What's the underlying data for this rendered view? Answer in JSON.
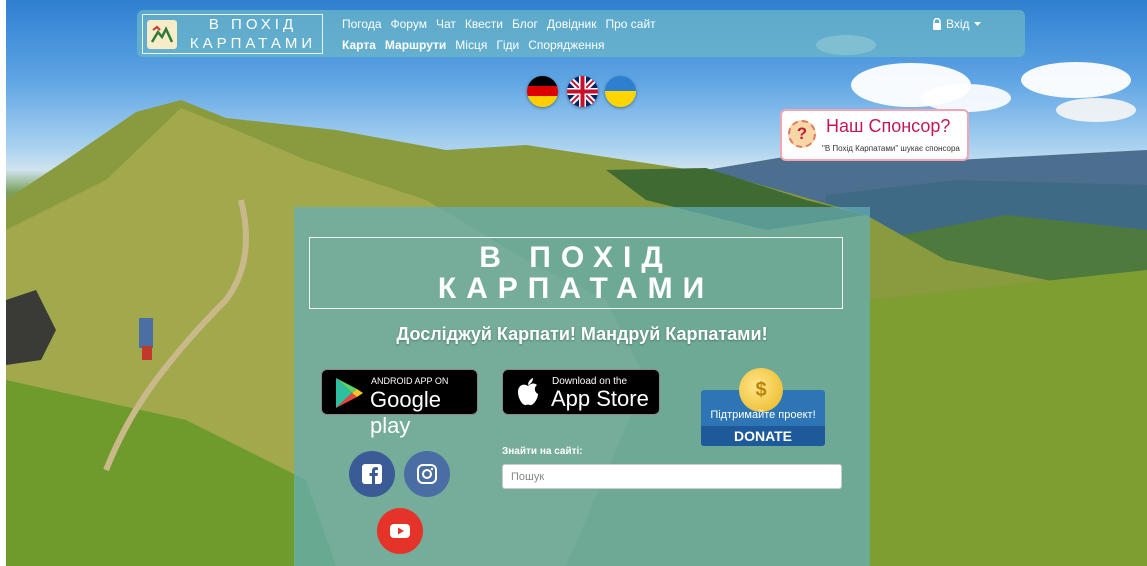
{
  "brand": {
    "line1": "В ПОХІД",
    "line2": "КАРПАТАМИ",
    "icon": "mountain-logo-icon"
  },
  "nav": {
    "row1": [
      "Погода",
      "Форум",
      "Чат",
      "Квести",
      "Блог",
      "Довідник",
      "Про сайт"
    ],
    "row2": [
      {
        "label": "Карта",
        "bold": true
      },
      {
        "label": "Маршрути",
        "bold": true
      },
      {
        "label": "Місця",
        "bold": false
      },
      {
        "label": "Гіди",
        "bold": false
      },
      {
        "label": "Спорядження",
        "bold": false
      }
    ],
    "login": "Вхід"
  },
  "flags": [
    "german-flag-icon",
    "uk-flag-icon",
    "ukrainian-flag-icon"
  ],
  "sponsor": {
    "title": "Наш Спонсор?",
    "subtitle": "\"В Похід Карпатами\" шукає спонсора",
    "mark": "?"
  },
  "hero": {
    "title_line1": "В ПОХІД",
    "title_line2": "КАРПАТАМИ",
    "tagline": "Досліджуй Карпати! Мандруй Карпатами!"
  },
  "stores": {
    "google": {
      "small": "ANDROID APP ON",
      "big": "Google play"
    },
    "apple": {
      "small": "Download on the",
      "big": "App Store"
    }
  },
  "donate": {
    "label": "Підтримайте проект!",
    "button": "DONATE",
    "coin": "$"
  },
  "social": [
    "facebook-icon",
    "instagram-icon",
    "youtube-icon"
  ],
  "search": {
    "label": "Знайти на сайті:",
    "placeholder": "Пошук",
    "value": ""
  },
  "colors": {
    "panel": "#64afb9",
    "navbar": "#6eb9c8",
    "donate": "#2e75b6",
    "youtube": "#e5332a",
    "facebook": "#3b5b96"
  }
}
